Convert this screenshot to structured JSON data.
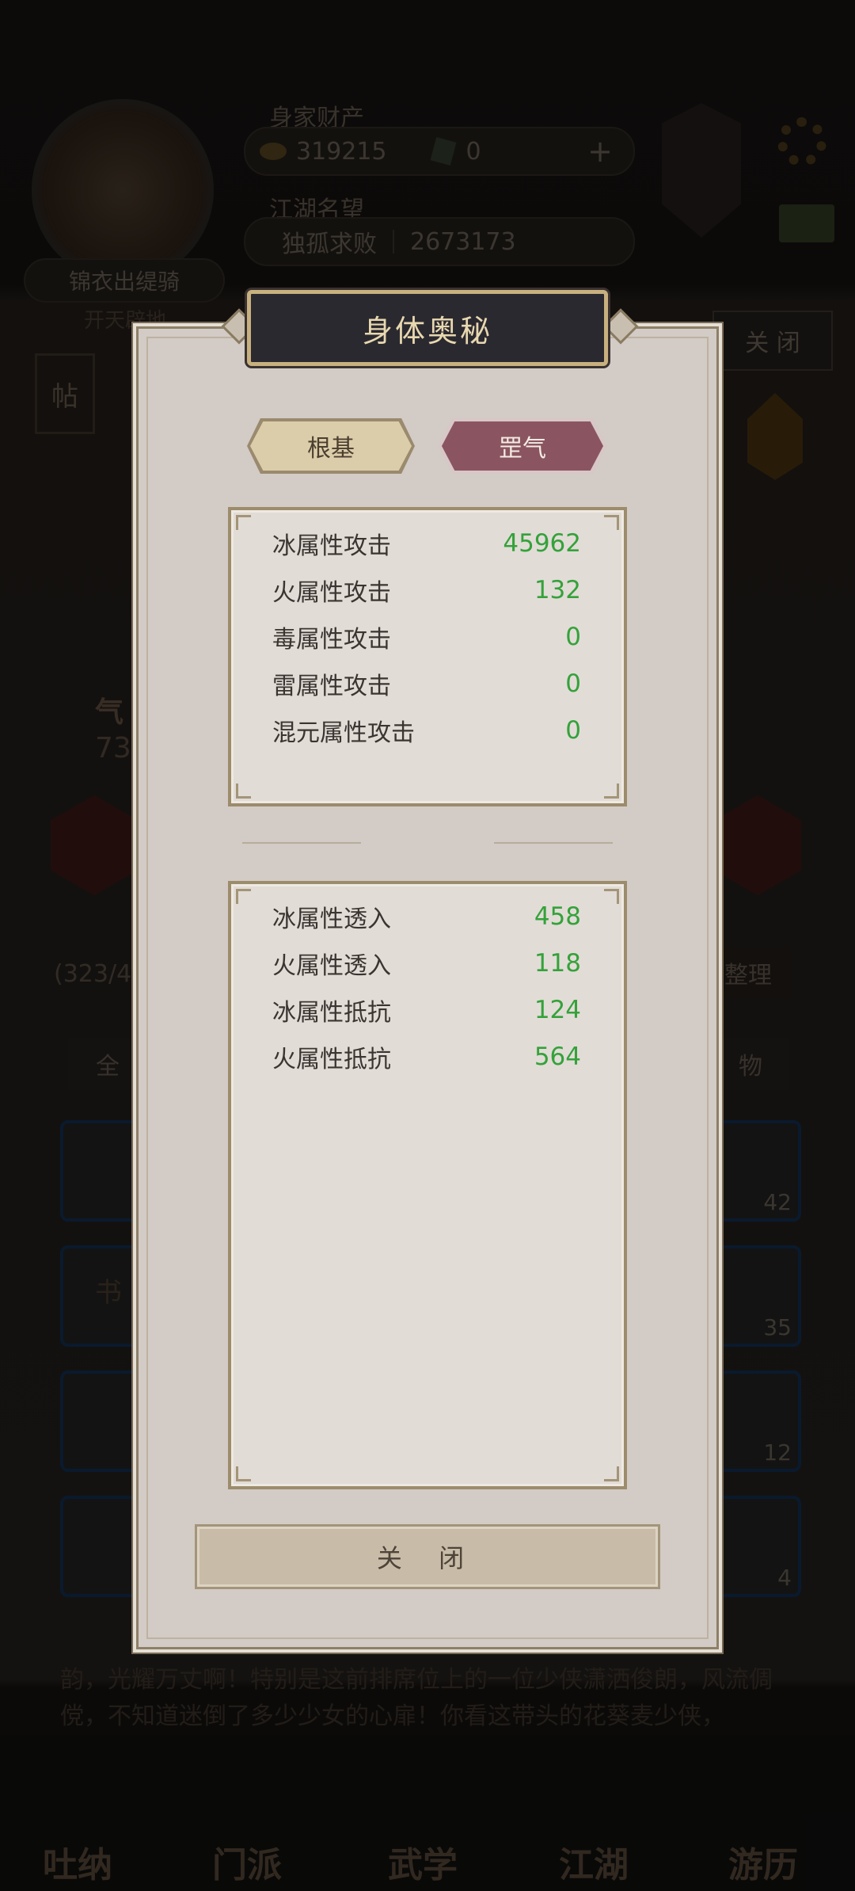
{
  "background": {
    "header": {
      "wealth_label": "身家财产",
      "coins": "319215",
      "gems": "0",
      "plus_symbol": "+",
      "fame_label": "江湖名望",
      "fame_title": "独孤求败",
      "fame_value": "2673173",
      "rank_badge": "锦衣出缇骑",
      "sub_badge": "开天辟地"
    },
    "post_label": "帖",
    "side_value": "73",
    "side_label": "气",
    "bag_count": "(323/40",
    "close_label": "关 闭",
    "sort_label": "整理",
    "filter_left": "全",
    "filter_right": "物",
    "slot_counts": [
      "42",
      "35",
      "12",
      "4"
    ],
    "slot_left_labels": [
      "书"
    ],
    "story_text": "韵，光耀万丈啊！特别是这前排席位上的一位少侠潇洒俊朗，风流倜傥，不知道迷倒了多少少女的心扉！你看这带头的花葵麦少侠，",
    "nav": [
      "吐纳",
      "门派",
      "武学",
      "江湖",
      "游历"
    ]
  },
  "modal": {
    "title": "身体奥秘",
    "tabs": [
      {
        "label": "根基",
        "active": false
      },
      {
        "label": "罡气",
        "active": true
      }
    ],
    "attack_stats": [
      {
        "label": "冰属性攻击",
        "value": "45962"
      },
      {
        "label": "火属性攻击",
        "value": "132"
      },
      {
        "label": "毒属性攻击",
        "value": "0"
      },
      {
        "label": "雷属性攻击",
        "value": "0"
      },
      {
        "label": "混元属性攻击",
        "value": "0"
      }
    ],
    "resist_stats": [
      {
        "label": "冰属性透入",
        "value": "458"
      },
      {
        "label": "火属性透入",
        "value": "118"
      },
      {
        "label": "冰属性抵抗",
        "value": "124"
      },
      {
        "label": "火属性抵抗",
        "value": "564"
      }
    ],
    "close_button": "关 闭"
  },
  "colors": {
    "value_green": "#34a23a",
    "title_gold": "#e8d8b0",
    "tab_inactive": "#d8c8a4",
    "tab_active": "#8a5560"
  }
}
